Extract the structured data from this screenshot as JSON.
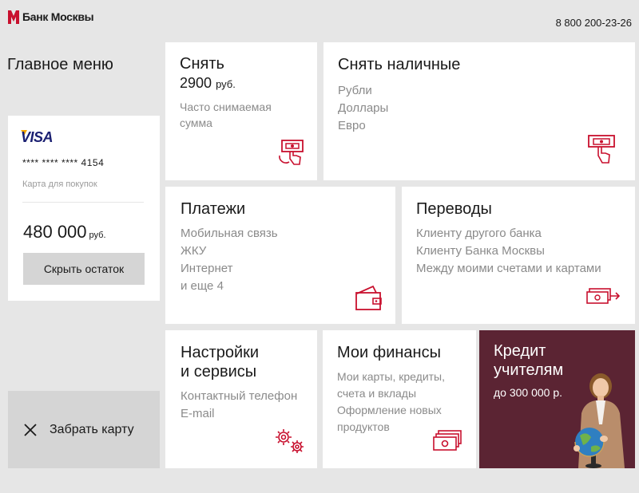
{
  "header": {
    "logo_text": "Банк Москвы",
    "phone": "8 800 200-23-26"
  },
  "menu_title": "Главное меню",
  "card": {
    "brand": "VISA",
    "number": "****  ****  ****  4154",
    "type": "Карта для покупок",
    "balance": "480 000",
    "currency": "руб.",
    "hide_button": "Скрыть остаток"
  },
  "eject": {
    "label": "Забрать карту"
  },
  "tiles": {
    "quick_withdraw": {
      "title": "Снять",
      "amount": "2900",
      "currency": "руб.",
      "sub": [
        "Часто снимаемая",
        "сумма"
      ]
    },
    "withdraw_cash": {
      "title": "Снять наличные",
      "items": [
        "Рубли",
        "Доллары",
        "Евро"
      ]
    },
    "payments": {
      "title": "Платежи",
      "items": [
        "Мобильная связь",
        "ЖКУ",
        "Интернет",
        "и еще 4"
      ]
    },
    "transfers": {
      "title": "Переводы",
      "items": [
        "Клиенту другого банка",
        "Клиенту Банка Москвы",
        "Между моими счетами и картами"
      ]
    },
    "settings": {
      "title_line1": "Настройки",
      "title_line2": "и сервисы",
      "items": [
        "Контактный телефон",
        "E-mail"
      ]
    },
    "finances": {
      "title": "Мои финансы",
      "items": [
        "Мои карты, кредиты,",
        "счета и вклады",
        "Оформление новых",
        "продуктов"
      ]
    },
    "credit": {
      "title_line1": "Кредит",
      "title_line2": "учителям",
      "sub": "до 300 000 р."
    }
  },
  "colors": {
    "brand_red": "#c8102e",
    "promo_bg": "#5b2433",
    "background": "#e6e6e6",
    "muted_text": "#8a8a8a"
  }
}
